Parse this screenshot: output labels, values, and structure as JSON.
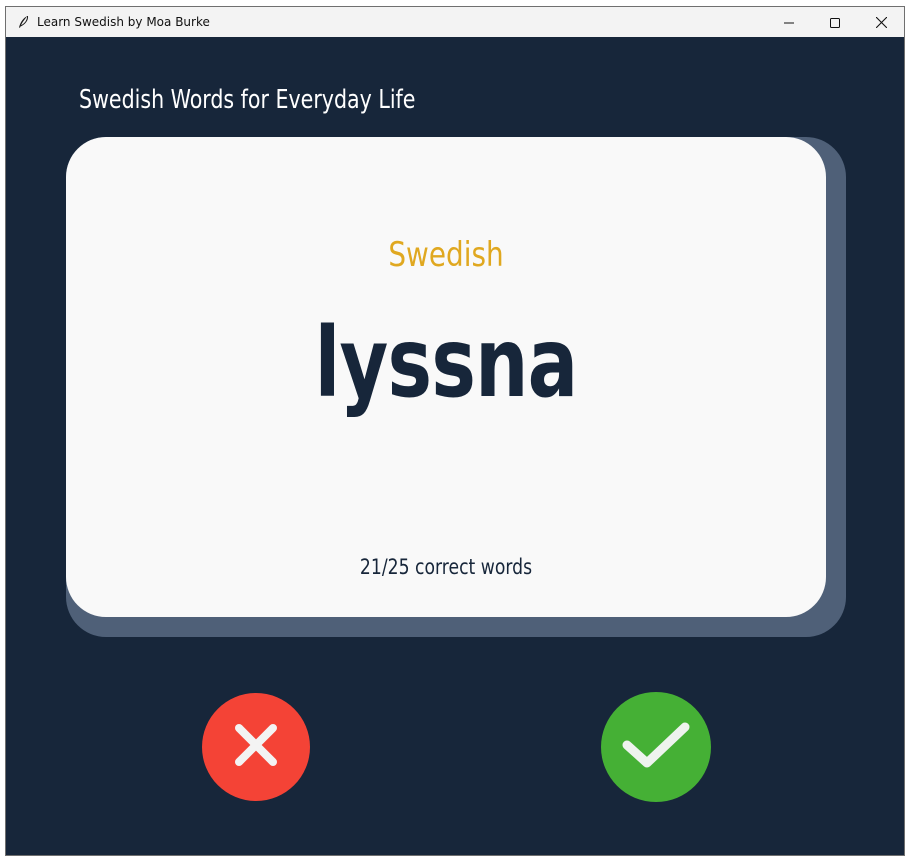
{
  "window": {
    "title": "Learn Swedish by Moa Burke",
    "icon": "feather-icon",
    "controls": [
      "minimize-icon",
      "maximize-icon",
      "close-icon"
    ]
  },
  "app": {
    "heading": "Swedish Words for Everyday Life",
    "card": {
      "language": "Swedish",
      "word": "lyssna",
      "score": "21/25 correct words"
    },
    "buttons": {
      "wrong": {
        "icon": "cross-icon",
        "color": "#f44336"
      },
      "right": {
        "icon": "checkmark-icon",
        "color": "#45b035"
      }
    }
  },
  "colors": {
    "background": "#17263a",
    "card": "#f9f9f9",
    "card_shadow": "#4f6078",
    "language_label": "#e0a820",
    "word_text": "#17263a"
  }
}
